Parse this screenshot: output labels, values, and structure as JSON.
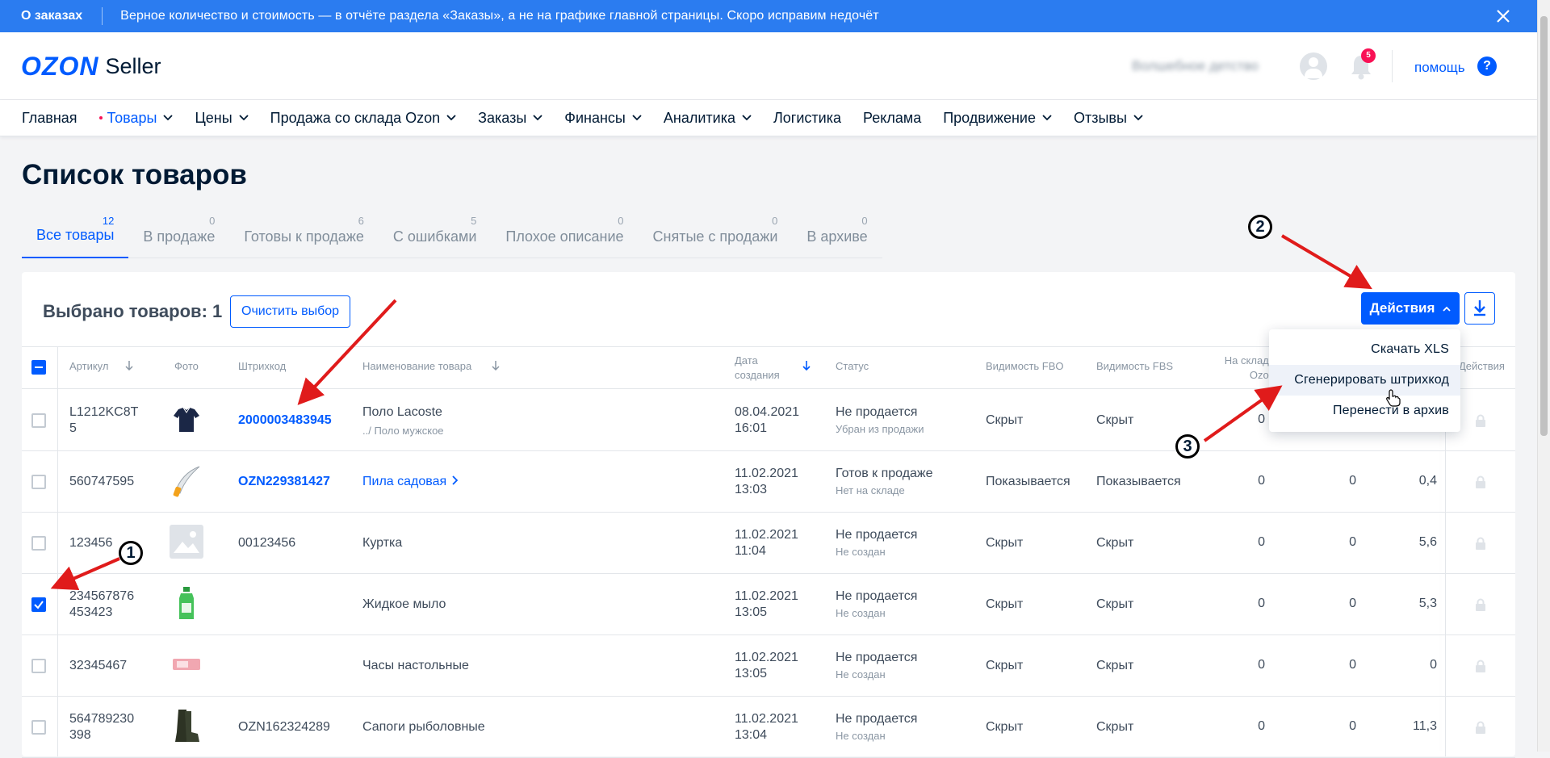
{
  "banner": {
    "title": "О заказах",
    "text": "Верное количество и стоимость — в отчёте раздела «Заказы», а не на графике главной страницы. Скоро исправим недочёт"
  },
  "header": {
    "logo_brand": "OZON",
    "logo_product": "Seller",
    "shop_name": "Волшебное детство",
    "notifications_count": "5",
    "help_label": "помощь",
    "help_icon_text": "?"
  },
  "nav": {
    "items": [
      {
        "label": "Главная"
      },
      {
        "label": "Товары"
      },
      {
        "label": "Цены"
      },
      {
        "label": "Продажа со склада Ozon"
      },
      {
        "label": "Заказы"
      },
      {
        "label": "Финансы"
      },
      {
        "label": "Аналитика"
      },
      {
        "label": "Логистика"
      },
      {
        "label": "Реклама"
      },
      {
        "label": "Продвижение"
      },
      {
        "label": "Отзывы"
      }
    ]
  },
  "page": {
    "title": "Список товаров"
  },
  "tabs": [
    {
      "label": "Все товары",
      "count": "12"
    },
    {
      "label": "В продаже",
      "count": "0"
    },
    {
      "label": "Готовы к продаже",
      "count": "6"
    },
    {
      "label": "С ошибками",
      "count": "5"
    },
    {
      "label": "Плохое описание",
      "count": "0"
    },
    {
      "label": "Снятые с продажи",
      "count": "0"
    },
    {
      "label": "В архиве",
      "count": "0"
    }
  ],
  "toolbar": {
    "selected_text": "Выбрано товаров: 1",
    "clear_label": "Очистить выбор",
    "actions_label": "Действия"
  },
  "dropdown": {
    "items": [
      "Скачать XLS",
      "Сгенерировать штрихкод",
      "Перенести в архив"
    ]
  },
  "table": {
    "headers": {
      "article": "Артикул",
      "photo": "Фото",
      "barcode": "Штрихкод",
      "name": "Наименование товара",
      "date_1": "Дата",
      "date_2": "создания",
      "status": "Статус",
      "vis_fbo": "Видимость FBO",
      "vis_fbs": "Видимость FBS",
      "stock_1": "На складе",
      "stock_2": "Ozon",
      "actions": "Действия"
    },
    "rows": [
      {
        "article_1": "L1212KC8T",
        "article_2": "5",
        "barcode": "2000003483945",
        "name": "Поло Lacoste",
        "name_sub": "../ Поло мужское",
        "date": "08.04.2021",
        "time": "16:01",
        "status": "Не продается",
        "status_sub": "Убран из продажи",
        "fbo": "Скрыт",
        "fbs": "Скрыт",
        "stock": "0",
        "n2": "",
        "n3": ""
      },
      {
        "article_1": "560747595",
        "article_2": "",
        "barcode": "OZN229381427",
        "name": "Пила садовая",
        "name_sub": "",
        "date": "11.02.2021",
        "time": "13:03",
        "status": "Готов к продаже",
        "status_sub": "Нет на складе",
        "fbo": "Показывается",
        "fbs": "Показывается",
        "stock": "0",
        "n2": "0",
        "n3": "0,4"
      },
      {
        "article_1": "123456",
        "article_2": "",
        "barcode": "00123456",
        "name": "Куртка",
        "name_sub": "",
        "date": "11.02.2021",
        "time": "11:04",
        "status": "Не продается",
        "status_sub": "Не создан",
        "fbo": "Скрыт",
        "fbs": "Скрыт",
        "stock": "0",
        "n2": "0",
        "n3": "5,6"
      },
      {
        "article_1": "234567876",
        "article_2": "453423",
        "barcode": "",
        "name": "Жидкое мыло",
        "name_sub": "",
        "date": "11.02.2021",
        "time": "13:05",
        "status": "Не продается",
        "status_sub": "Не создан",
        "fbo": "Скрыт",
        "fbs": "Скрыт",
        "stock": "0",
        "n2": "0",
        "n3": "5,3"
      },
      {
        "article_1": "32345467",
        "article_2": "",
        "barcode": "",
        "name": "Часы настольные",
        "name_sub": "",
        "date": "11.02.2021",
        "time": "13:05",
        "status": "Не продается",
        "status_sub": "Не создан",
        "fbo": "Скрыт",
        "fbs": "Скрыт",
        "stock": "0",
        "n2": "0",
        "n3": "0"
      },
      {
        "article_1": "564789230",
        "article_2": "398",
        "barcode": "OZN162324289",
        "name": "Сапоги рыболовные",
        "name_sub": "",
        "date": "11.02.2021",
        "time": "13:04",
        "status": "Не продается",
        "status_sub": "Не создан",
        "fbo": "Скрыт",
        "fbs": "Скрыт",
        "stock": "0",
        "n2": "0",
        "n3": "11,3"
      }
    ]
  },
  "annotations": {
    "step_1": "1",
    "step_2": "2",
    "step_3": "3"
  },
  "colors": {
    "brand_blue": "#005bff",
    "banner_blue": "#2b7cf0",
    "annotation_red": "#e01b1b",
    "badge_pink": "#f91155"
  }
}
